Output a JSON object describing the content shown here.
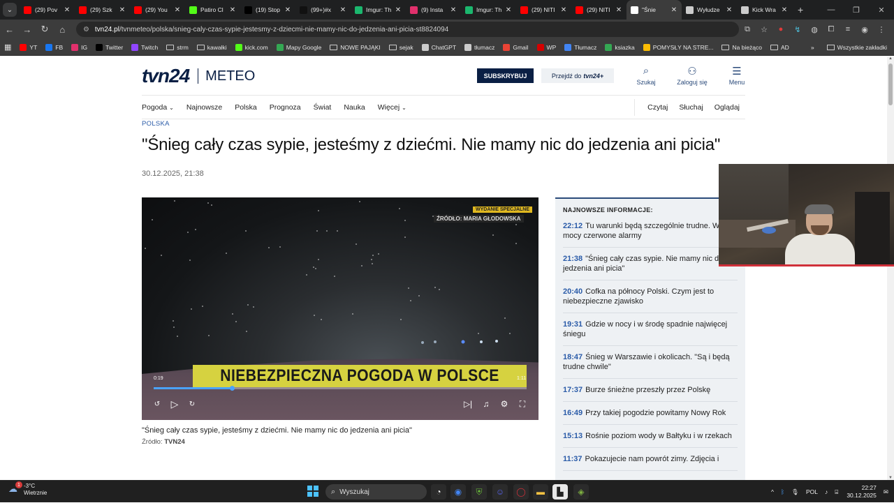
{
  "browser": {
    "tabs": [
      {
        "label": "(29) Pov",
        "color": "#ff0000",
        "active": false
      },
      {
        "label": "(29) Szk",
        "color": "#ff0000",
        "active": false
      },
      {
        "label": "(29) You",
        "color": "#ff0000",
        "active": false
      },
      {
        "label": "Patiro Cl",
        "color": "#53fc18",
        "active": false
      },
      {
        "label": "(19) Stop",
        "color": "#000000",
        "active": false
      },
      {
        "label": "(99+)#x",
        "color": "#111111",
        "active": false
      },
      {
        "label": "Imgur: Th",
        "color": "#1bb76e",
        "active": false
      },
      {
        "label": "(9) Insta",
        "color": "#e1306c",
        "active": false
      },
      {
        "label": "Imgur: Th",
        "color": "#1bb76e",
        "active": false
      },
      {
        "label": "(29) NITI",
        "color": "#ff0000",
        "active": false
      },
      {
        "label": "(29) NITI",
        "color": "#ff0000",
        "active": false
      },
      {
        "label": "\"Śnie",
        "color": "#ffffff",
        "active": true
      },
      {
        "label": "Wyłudze",
        "color": "#cccccc",
        "active": false
      },
      {
        "label": "Kick Wra",
        "color": "#cccccc",
        "active": false
      }
    ],
    "url_host": "tvn24.pl",
    "url_path": "/tvnmeteo/polska/snieg-caly-czas-sypie-jestesmy-z-dziecmi-nie-mamy-nic-do-jedzenia-ani-picia-st8824094",
    "bookmarks": [
      {
        "label": "YT",
        "icon": "youtube-icon",
        "color": "#ff0000"
      },
      {
        "label": "FB",
        "icon": "facebook-icon",
        "color": "#1877f2"
      },
      {
        "label": "IG",
        "icon": "instagram-icon",
        "color": "#e1306c"
      },
      {
        "label": "Twitter",
        "icon": "x-icon",
        "color": "#000000"
      },
      {
        "label": "Twitch",
        "icon": "twitch-icon",
        "color": "#9146ff"
      },
      {
        "label": "strm",
        "icon": "folder-icon",
        "color": ""
      },
      {
        "label": "kawałki",
        "icon": "folder-icon",
        "color": ""
      },
      {
        "label": "kick.com",
        "icon": "kick-icon",
        "color": "#53fc18"
      },
      {
        "label": "Mapy Google",
        "icon": "maps-icon",
        "color": "#34a853"
      },
      {
        "label": "NOWE PAJĄKI",
        "icon": "folder-icon",
        "color": ""
      },
      {
        "label": "sejak",
        "icon": "folder-icon",
        "color": ""
      },
      {
        "label": "ChatGPT",
        "icon": "chatgpt-icon",
        "color": "#cccccc"
      },
      {
        "label": "tłumacz",
        "icon": "globe-icon",
        "color": "#cccccc"
      },
      {
        "label": "Gmail",
        "icon": "gmail-icon",
        "color": "#ea4335"
      },
      {
        "label": "WP",
        "icon": "wp-icon",
        "color": "#d50000"
      },
      {
        "label": "Tłumacz",
        "icon": "translate-icon",
        "color": "#4285f4"
      },
      {
        "label": "ksiazka",
        "icon": "book-icon",
        "color": "#34a853"
      },
      {
        "label": "POMYSŁY NA STRE...",
        "icon": "sheet-icon",
        "color": "#fbbc04"
      },
      {
        "label": "Na bieżąco",
        "icon": "folder-icon",
        "color": ""
      },
      {
        "label": "AD",
        "icon": "folder-icon",
        "color": ""
      }
    ],
    "all_bookmarks": "Wszystkie zakładki"
  },
  "site": {
    "logo": "tvn24",
    "section": "METEO",
    "subscribe": "SUBSKRYBUJ",
    "goto_prefix": "Przejdź do",
    "goto_brand": "tvn24+",
    "search": "Szukaj",
    "login": "Zaloguj się",
    "menu": "Menu",
    "nav": [
      "Pogoda",
      "Najnowsze",
      "Polska",
      "Prognoza",
      "Świat",
      "Nauka",
      "Więcej"
    ],
    "nav_right": [
      "Czytaj",
      "Słuchaj",
      "Oglądaj"
    ]
  },
  "article": {
    "category": "POLSKA",
    "title": "\"Śnieg cały czas sypie, jesteśmy z dziećmi. Nie mamy nic do jedzenia ani picia\"",
    "date": "30.12.2025, 21:38",
    "video": {
      "badge_top": "WYDANIE SPECJALNE",
      "badge_source": "ŹRÓDŁO: MARIA GŁODOWSKA",
      "ticker": "NIEBEZPIECZNA POGODA W POLSCE",
      "time_current": "0:19",
      "time_total": "1:11",
      "progress": 0.21
    },
    "caption": "\"Śnieg cały czas sypie, jesteśmy z dziećmi. Nie mamy nic do jedzenia ani picia\"",
    "source_label": "Źródło:",
    "source_value": "TVN24"
  },
  "news": {
    "header": "NAJNOWSZE INFORMACJE:",
    "items": [
      {
        "time": "22:12",
        "text": "Tu warunki będą szczególnie trudne. W mocy czerwone alarmy"
      },
      {
        "time": "21:38",
        "text": "\"Śnieg cały czas sypie. Nie mamy nic do jedzenia ani picia\""
      },
      {
        "time": "20:40",
        "text": "Cofka na północy Polski. Czym jest to niebezpieczne zjawisko"
      },
      {
        "time": "19:31",
        "text": "Gdzie w nocy i w środę spadnie najwięcej śniegu"
      },
      {
        "time": "18:47",
        "text": "Śnieg w Warszawie i okolicach. \"Są i będą trudne chwile\""
      },
      {
        "time": "17:37",
        "text": "Burze śnieżne przeszły przez Polskę"
      },
      {
        "time": "16:49",
        "text": "Przy takiej pogodzie powitamy Nowy Rok"
      },
      {
        "time": "15:13",
        "text": "Rośnie poziom wody w Bałtyku i w rzekach"
      },
      {
        "time": "11:37",
        "text": "Pokazujecie nam powrót zimy. Zdjęcia i"
      }
    ]
  },
  "taskbar": {
    "temp": "-3°C",
    "weather": "Wietrznie",
    "weather_badge": "1",
    "search": "Wyszukaj",
    "lang": "POL",
    "time": "22:27",
    "date": "30.12.2025"
  }
}
